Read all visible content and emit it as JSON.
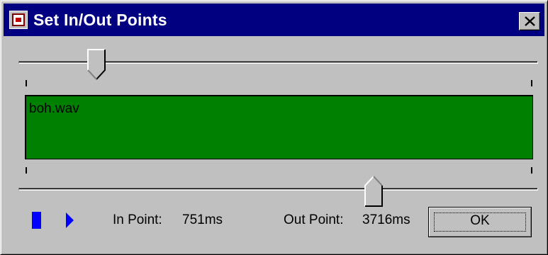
{
  "window": {
    "title": "Set In/Out Points",
    "icon": "film-clip-icon",
    "close_icon": "close-x-icon"
  },
  "in_slider": {
    "position_ms": 751
  },
  "out_slider": {
    "position_ms": 3716
  },
  "waveform": {
    "file_name": "boh.wav",
    "background_color": "#008000"
  },
  "controls": {
    "stop_icon": "stop-icon",
    "play_icon": "play-icon",
    "icon_color": "#0000ff"
  },
  "in_point": {
    "label": "In Point:",
    "value": "751ms"
  },
  "out_point": {
    "label": "Out Point:",
    "value": "3716ms"
  },
  "ok_button": {
    "label": "OK"
  }
}
